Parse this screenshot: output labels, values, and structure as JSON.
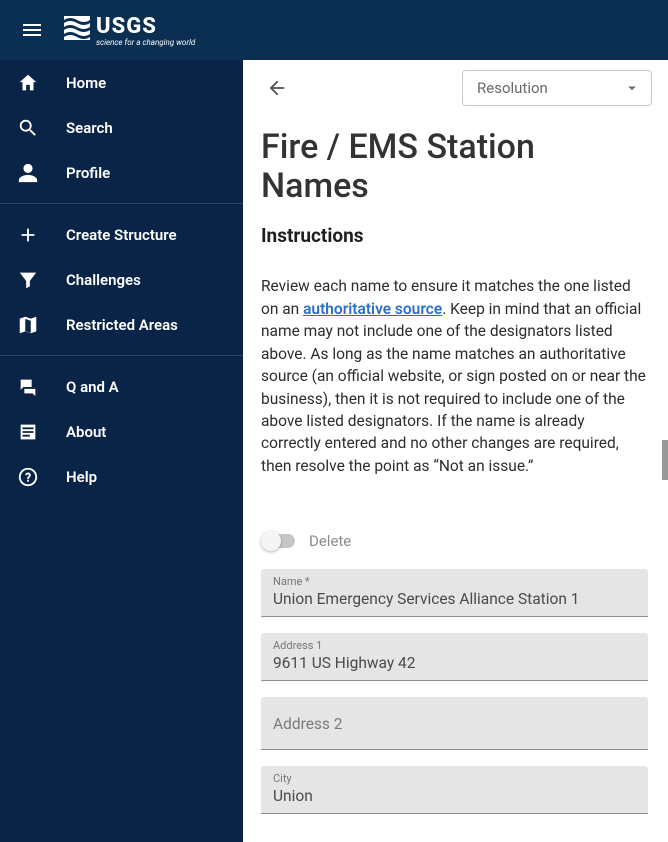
{
  "header": {
    "logo_text": "USGS",
    "tagline": "science for a changing world"
  },
  "sidebar": {
    "items": [
      {
        "label": "Home",
        "icon": "home-icon"
      },
      {
        "label": "Search",
        "icon": "search-icon"
      },
      {
        "label": "Profile",
        "icon": "person-icon"
      },
      {
        "label": "Create Structure",
        "icon": "plus-icon"
      },
      {
        "label": "Challenges",
        "icon": "filter-icon"
      },
      {
        "label": "Restricted Areas",
        "icon": "map-icon"
      },
      {
        "label": "Q and A",
        "icon": "qa-icon"
      },
      {
        "label": "About",
        "icon": "list-icon"
      },
      {
        "label": "Help",
        "icon": "help-icon"
      }
    ]
  },
  "topbar": {
    "resolution_label": "Resolution"
  },
  "page": {
    "title": "Fire / EMS Station Names",
    "instructions_heading": "Instructions",
    "instructions_pre": "Review each name to ensure it matches the one listed on an ",
    "instructions_link": "authoritative source",
    "instructions_post": ". Keep in mind that an official name may not include one of the designators listed above. As long as the name matches an authoritative source (an official website, or sign posted on or near the business), then it is not required to include one of the above listed designators. If the name is already correctly entered and no other changes are required, then resolve the point as “Not an issue.”"
  },
  "form": {
    "delete_label": "Delete",
    "name_label": "Name *",
    "name_value": "Union Emergency Services Alliance Station 1",
    "address1_label": "Address 1",
    "address1_value": "9611 US Highway 42",
    "address2_placeholder": "Address 2",
    "city_label": "City",
    "city_value": "Union"
  }
}
